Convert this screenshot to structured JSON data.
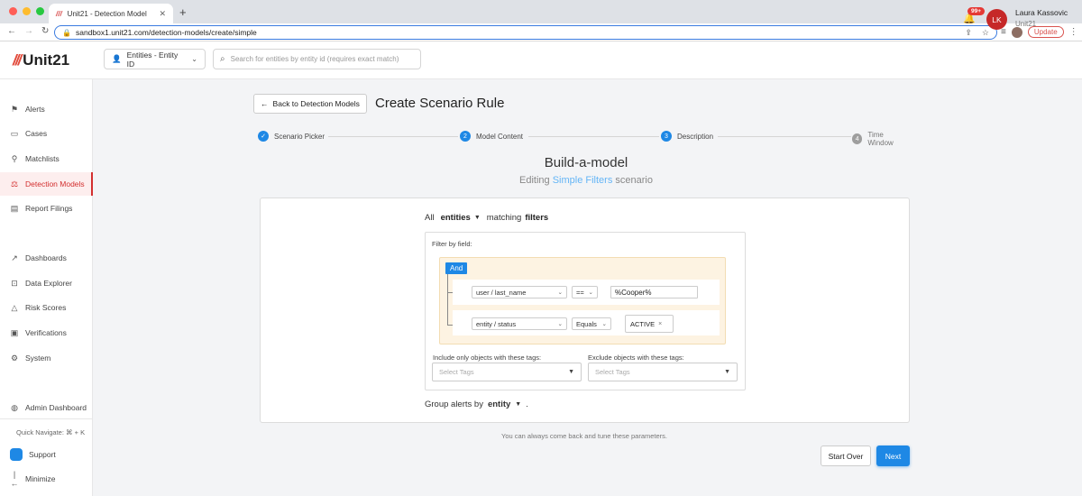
{
  "browser": {
    "tab_title": "Unit21 - Detection Model",
    "tab_favicon": "///",
    "url": "sandbox1.unit21.com/detection-models/create/simple",
    "update_label": "Update"
  },
  "header": {
    "logo_text": "Unit21",
    "logo_mark": "///",
    "entity_select": "Entities - Entity ID",
    "search_placeholder": "Search for entities by entity id (requires exact match)",
    "notification_badge": "99+",
    "user_initials": "LK",
    "user_name": "Laura Kassovic",
    "user_org": "Unit21"
  },
  "sidebar": {
    "items": [
      {
        "label": "Alerts",
        "icon": "flag-icon"
      },
      {
        "label": "Cases",
        "icon": "briefcase-icon"
      },
      {
        "label": "Matchlists",
        "icon": "person-add-icon"
      },
      {
        "label": "Detection Models",
        "icon": "model-icon"
      },
      {
        "label": "Report Filings",
        "icon": "report-icon"
      },
      {
        "label": "Dashboards",
        "icon": "chart-icon"
      },
      {
        "label": "Data Explorer",
        "icon": "explorer-icon"
      },
      {
        "label": "Risk Scores",
        "icon": "warning-icon"
      },
      {
        "label": "Verifications",
        "icon": "id-card-icon"
      },
      {
        "label": "System",
        "icon": "gear-icon"
      },
      {
        "label": "Admin Dashboard",
        "icon": "globe-icon"
      }
    ],
    "quick_navigate": "Quick Navigate: ⌘ + K",
    "support": "Support",
    "minimize": "Minimize"
  },
  "main": {
    "back_button": "Back to Detection Models",
    "page_title": "Create Scenario Rule",
    "steps": [
      {
        "label": "Scenario Picker",
        "marker": "✓",
        "state": "done"
      },
      {
        "label": "Model Content",
        "marker": "2",
        "state": "active"
      },
      {
        "label": "Description",
        "marker": "3",
        "state": "active"
      },
      {
        "label": "Time Window",
        "marker": "4",
        "state": "inactive"
      }
    ],
    "build_title": "Build-a-model",
    "editing_prefix": "Editing",
    "editing_link": "Simple Filters",
    "editing_suffix": "scenario",
    "all_label": "All",
    "entities_label": "entities",
    "matching_label": "matching",
    "filters_label": "filters",
    "filter_by_field": "Filter by field:",
    "and_label": "And",
    "rules": [
      {
        "field": "user / last_name",
        "operator": "==",
        "value": "%Cooper%"
      },
      {
        "field": "entity / status",
        "operator": "Equals",
        "value": "ACTIVE"
      }
    ],
    "include_tags_label": "Include only objects with these tags:",
    "exclude_tags_label": "Exclude objects with these tags:",
    "select_tags_placeholder": "Select Tags",
    "group_alerts_prefix": "Group alerts by",
    "group_alerts_value": "entity",
    "group_alerts_suffix": ".",
    "hint": "You can always come back and tune these parameters.",
    "start_over": "Start Over",
    "next": "Next"
  },
  "colors": {
    "accent": "#1e88e5",
    "brand": "#e24a3b",
    "active_nav": "#d32f2f"
  }
}
